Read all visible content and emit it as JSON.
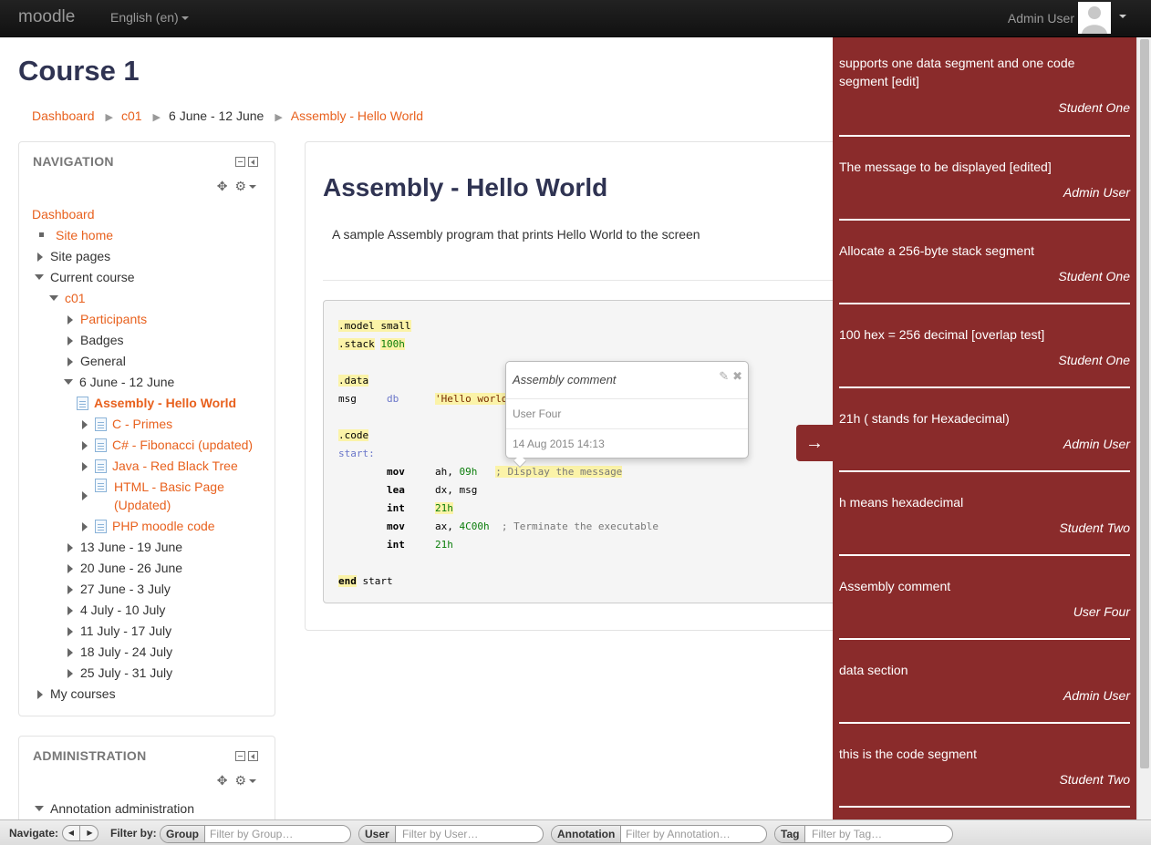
{
  "navbar": {
    "brand": "moodle",
    "language": "English (en)",
    "user": "Admin User"
  },
  "course_title": "Course 1",
  "breadcrumb": [
    "Dashboard",
    "c01",
    "6 June - 12 June",
    "Assembly - Hello World"
  ],
  "navigation": {
    "title": "NAVIGATION",
    "items": {
      "dashboard": "Dashboard",
      "site_home": "Site home",
      "site_pages": "Site pages",
      "current_course": "Current course",
      "c01": "c01",
      "participants": "Participants",
      "badges": "Badges",
      "general": "General",
      "week_jun6": "6 June - 12 June",
      "assembly": "Assembly - Hello World",
      "c_primes": "C - Primes",
      "csharp": "C# - Fibonacci (updated)",
      "java": "Java - Red Black Tree",
      "html_1": "HTML - Basic Page",
      "html_2": "(Updated)",
      "php": "PHP moodle code",
      "week_jun13": "13 June - 19 June",
      "week_jun20": "20 June - 26 June",
      "week_jun27": "27 June - 3 July",
      "week_jul4": "4 July - 10 July",
      "week_jul11": "11 July - 17 July",
      "week_jul18": "18 July - 24 July",
      "week_jul25": "25 July - 31 July",
      "my_courses": "My courses"
    }
  },
  "administration": {
    "title": "ADMINISTRATION",
    "item": "Annotation administration"
  },
  "page": {
    "heading": "Assembly - Hello World",
    "description": "A sample Assembly program that prints Hello World to the screen"
  },
  "code": {
    "model": ".model",
    "small": "small",
    "stack": ".stack",
    "stack_val": "100h",
    "data": ".data",
    "msg": "msg",
    "db": "db",
    "hello": "'Hello world",
    "codeseg": ".code",
    "start_label": "start:",
    "mov1": "mov",
    "mov1_args_a": "ah,",
    "mov1_args_b": "09h",
    "mov1_comment": "; Display the message",
    "lea": "lea",
    "lea_args": "dx, msg",
    "int1": "int",
    "int1_arg": "21h",
    "mov2": "mov",
    "mov2_a": "ax,",
    "mov2_b": "4C00h",
    "mov2_comment": "; Terminate the executable",
    "int2": "int",
    "int2_arg": "21h",
    "end": "end",
    "end_arg": "start"
  },
  "popover": {
    "title": "Assembly comment",
    "user": "User Four",
    "date": "14 Aug 2015 14:13"
  },
  "annotations": [
    {
      "text": "supports one data segment and one code segment [edit]",
      "user": "Student One"
    },
    {
      "text": "The message to be displayed [edited]",
      "user": "Admin User"
    },
    {
      "text": "Allocate a 256-byte stack segment",
      "user": "Student One"
    },
    {
      "text": "100 hex = 256 decimal [overlap test]",
      "user": "Student One"
    },
    {
      "text": "21h ( stands for Hexadecimal)",
      "user": "Admin User"
    },
    {
      "text": "h means hexadecimal",
      "user": "Student Two"
    },
    {
      "text": "Assembly comment",
      "user": "User Four"
    },
    {
      "text": "data section",
      "user": "Admin User"
    },
    {
      "text": "this is the code segment",
      "user": "Student Two"
    }
  ],
  "toggle_arrow": "→",
  "filterbar": {
    "navigate": "Navigate:",
    "filter_by": "Filter by:",
    "group_label": "Group",
    "group_placeholder": "Filter by Group…",
    "user_label": "User",
    "user_placeholder": "Filter by User…",
    "annotation_label": "Annotation",
    "annotation_placeholder": "Filter by Annotation…",
    "tag_label": "Tag",
    "tag_placeholder": "Filter by Tag…"
  }
}
